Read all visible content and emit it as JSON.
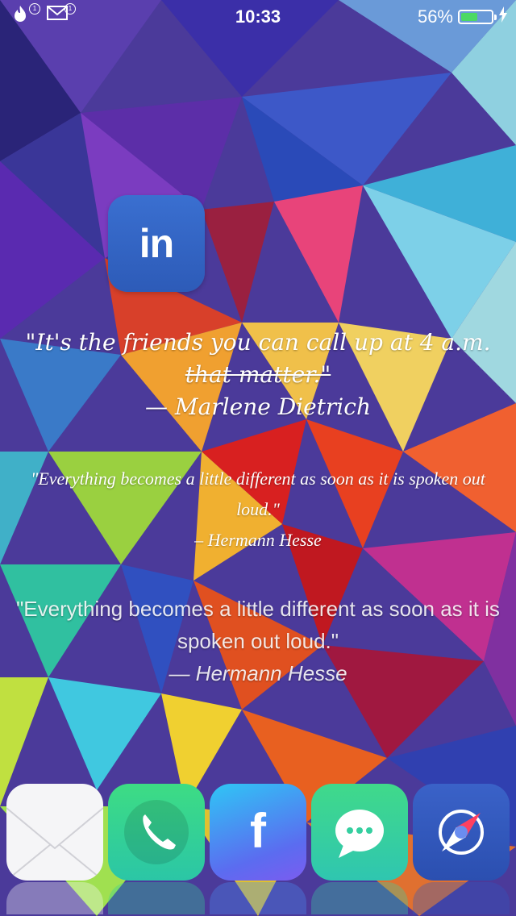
{
  "status_bar": {
    "time": "10:33",
    "battery_percent": "56%",
    "battery_level": 0.56,
    "left_icons": [
      {
        "icon": "flame-icon",
        "badge": "1"
      },
      {
        "icon": "mail-icon",
        "badge": "1"
      }
    ],
    "charging_icon": "bolt-icon"
  },
  "home_icons": [
    {
      "name": "linkedin-app",
      "glyph": "in"
    }
  ],
  "quotes": [
    {
      "line1": "\"It's the friends you can call up at 4 a.m.",
      "line2": "that matter.\"",
      "author": "— Marlene Dietrich"
    },
    {
      "text": "\"Everything becomes a little different as soon as it is spoken out loud.\"",
      "author": "– Hermann Hesse"
    },
    {
      "text": "\"Everything becomes a little different as soon as it is spoken out loud.\"",
      "author": "— Hermann Hesse"
    }
  ],
  "dock": [
    "mail-app",
    "phone-app",
    "facebook-app",
    "messages-app",
    "safari-app"
  ],
  "dock_glyphs": {
    "facebook": "f"
  },
  "colors": {
    "battery_fill": "#4cd964",
    "linkedin_tile": "#2d5bb8"
  }
}
